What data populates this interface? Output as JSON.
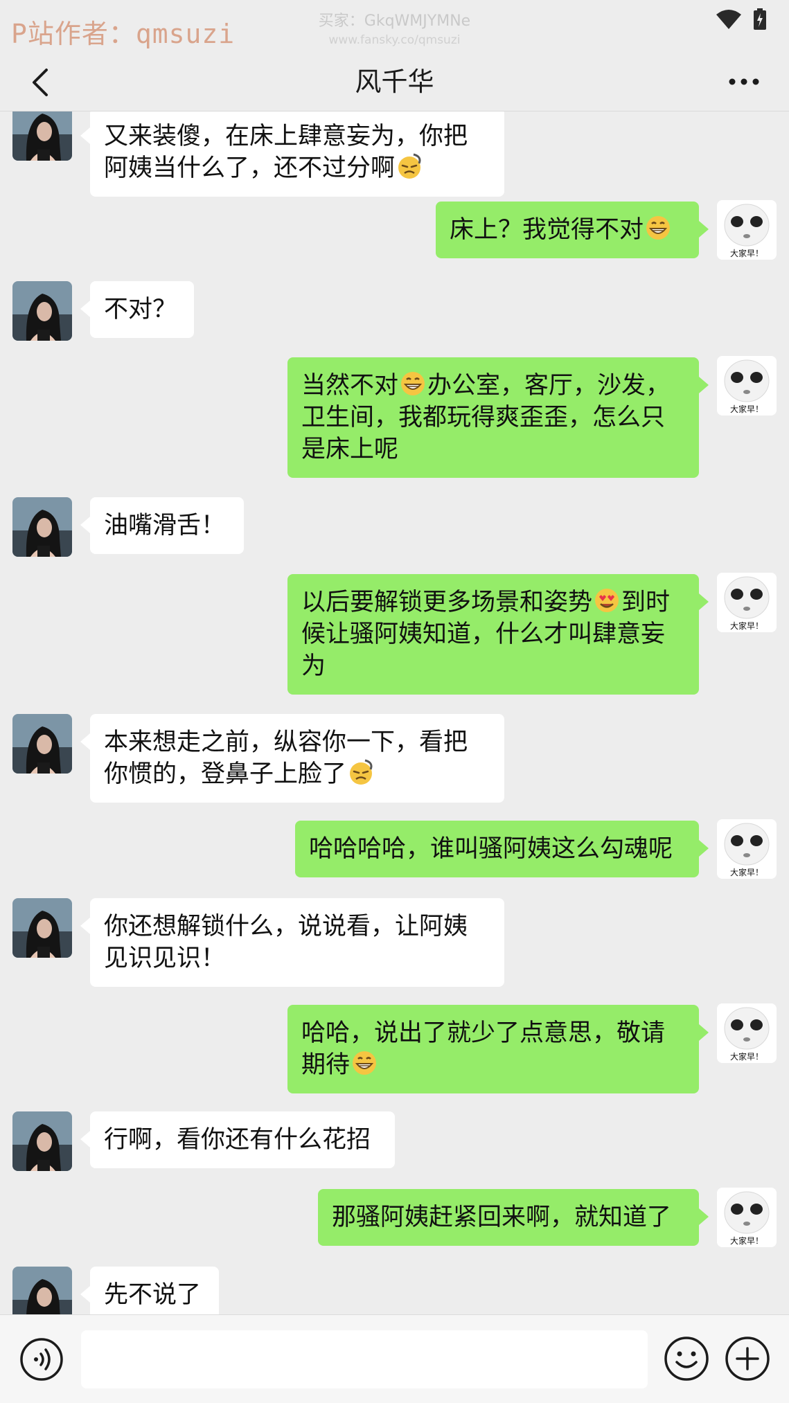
{
  "status_bar": {
    "watermark_author": "P站作者：qmsuzi",
    "watermark_buyer": "买家：GkqWMJYMNe",
    "watermark_site": "www.fansky.co/qmsuzi",
    "icons": [
      "wifi-icon",
      "battery-icon"
    ]
  },
  "nav": {
    "back_icon": "chevron-left-icon",
    "title": "风千华",
    "more_icon": "more-dots-icon"
  },
  "self_avatar_caption": "大家早！",
  "colors": {
    "background": "#ededed",
    "self_bubble": "#95ec69",
    "other_bubble": "#ffffff"
  },
  "messages": [
    {
      "side": "left",
      "lines": [
        "又来装傻，在床上肆意妄为，你把",
        "阿姨当什么了，还不过分啊"
      ],
      "emoji": "frustrated-emoji"
    },
    {
      "side": "right",
      "lines": [
        "床上？我觉得不对"
      ],
      "emoji": "grin-emoji"
    },
    {
      "side": "left",
      "lines": [
        "不对？"
      ]
    },
    {
      "side": "right",
      "parts": [
        "当然不对",
        "办公室，客厅，沙发，",
        "卫生间，我都玩得爽歪歪，怎么只",
        "是床上呢"
      ],
      "emoji": "grin-emoji"
    },
    {
      "side": "left",
      "lines": [
        "油嘴滑舌！"
      ]
    },
    {
      "side": "right",
      "parts": [
        "以后要解锁更多场景和姿势",
        "到时",
        "候让骚阿姨知道，什么才叫肆意妄",
        "为"
      ],
      "emoji": "heart-eyes-emoji"
    },
    {
      "side": "left",
      "lines": [
        "本来想走之前，纵容你一下，看把",
        "你惯的，登鼻子上脸了"
      ],
      "emoji": "frustrated-emoji"
    },
    {
      "side": "right",
      "lines": [
        "哈哈哈哈，谁叫骚阿姨这么勾魂呢"
      ]
    },
    {
      "side": "left",
      "lines": [
        "你还想解锁什么，说说看，让阿姨",
        "见识见识！"
      ]
    },
    {
      "side": "right",
      "lines": [
        "哈哈，说出了就少了点意思，敬请",
        "期待"
      ],
      "emoji": "grin-emoji"
    },
    {
      "side": "left",
      "lines": [
        "行啊，看你还有什么花招"
      ]
    },
    {
      "side": "right",
      "lines": [
        "那骚阿姨赶紧回来啊，就知道了"
      ]
    },
    {
      "side": "left",
      "lines": [
        "先不说了"
      ]
    }
  ],
  "input_bar": {
    "voice_icon": "voice-icon",
    "input_value": "",
    "emoji_icon": "smiley-icon",
    "plus_icon": "plus-icon"
  }
}
